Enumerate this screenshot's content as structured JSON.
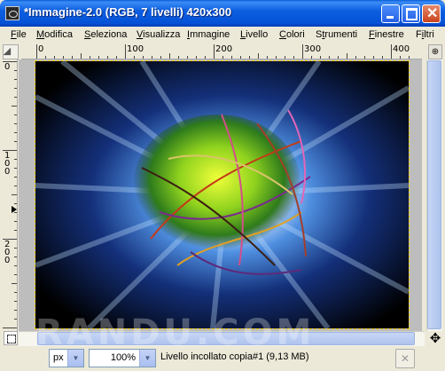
{
  "window": {
    "title": "*Immagine-2.0 (RGB, 7 livelli) 420x300"
  },
  "menu": [
    {
      "pre": "",
      "mn": "F",
      "post": "ile"
    },
    {
      "pre": "",
      "mn": "M",
      "post": "odifica"
    },
    {
      "pre": "",
      "mn": "S",
      "post": "eleziona"
    },
    {
      "pre": "",
      "mn": "V",
      "post": "isualizza"
    },
    {
      "pre": "",
      "mn": "I",
      "post": "mmagine"
    },
    {
      "pre": "",
      "mn": "L",
      "post": "ivello"
    },
    {
      "pre": "",
      "mn": "C",
      "post": "olori"
    },
    {
      "pre": "S",
      "mn": "t",
      "post": "rumenti"
    },
    {
      "pre": "",
      "mn": "F",
      "post": "inestre"
    },
    {
      "pre": "F",
      "mn": "i",
      "post": "ltri"
    }
  ],
  "ruler_top_labels": [
    "0",
    "100",
    "200",
    "300",
    "400"
  ],
  "ruler_left_labels": [
    "0",
    "100",
    "200"
  ],
  "statusbar": {
    "unit": "px",
    "zoom": "100%",
    "message": "Livello incollato copia#1 (9,13 MB)"
  },
  "watermark": "RANDU.COM",
  "icons": {
    "app": "gimp-icon",
    "minimize": "minimize-icon",
    "maximize": "maximize-icon",
    "close": "close-icon",
    "ruler_corner": "menu-arrow-icon",
    "navigate": "navigate-icon",
    "quickmask": "quick-mask-icon",
    "cancel": "cancel-icon"
  }
}
